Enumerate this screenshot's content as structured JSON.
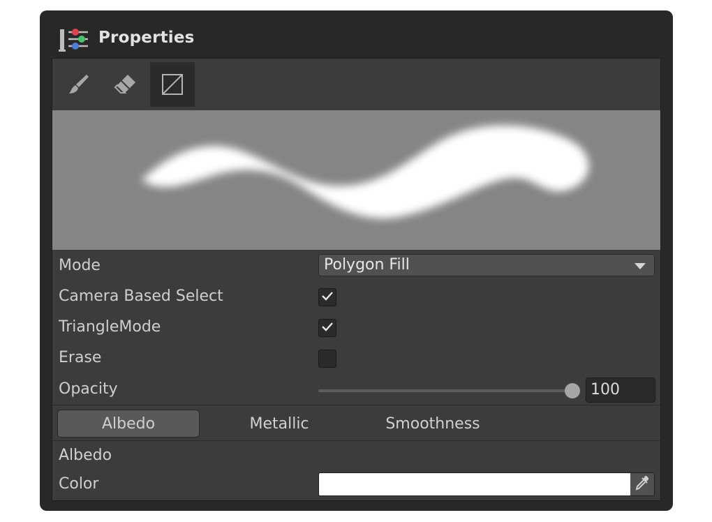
{
  "window": {
    "title": "Properties",
    "title_icon": "properties-sliders-icon"
  },
  "toolbar": {
    "tools": [
      {
        "name": "brush",
        "icon": "brush-icon",
        "active": false
      },
      {
        "name": "eraser",
        "icon": "eraser-icon",
        "active": false
      },
      {
        "name": "polygon-fill",
        "icon": "polygon-fill-icon",
        "active": true
      }
    ]
  },
  "preview": {
    "background": "#858585",
    "stroke_color": "#ffffff"
  },
  "fields": {
    "mode": {
      "label": "Mode",
      "value": "Polygon Fill"
    },
    "camera_based_select": {
      "label": "Camera Based Select",
      "checked": true
    },
    "triangle_mode": {
      "label": "TriangleMode",
      "checked": true
    },
    "erase": {
      "label": "Erase",
      "checked": false
    },
    "opacity": {
      "label": "Opacity",
      "value": "100",
      "fraction": 1.0
    }
  },
  "tabs": [
    {
      "label": "Albedo",
      "active": true
    },
    {
      "label": "Metallic",
      "active": false
    },
    {
      "label": "Smoothness",
      "active": false
    }
  ],
  "section": {
    "title": "Albedo"
  },
  "color": {
    "label": "Color",
    "value": "#ffffff",
    "picker_icon": "eyedropper-icon"
  },
  "theme": {
    "window_bg": "#282828",
    "panel_bg": "#3c3c3c",
    "active_tab": "#595959"
  }
}
